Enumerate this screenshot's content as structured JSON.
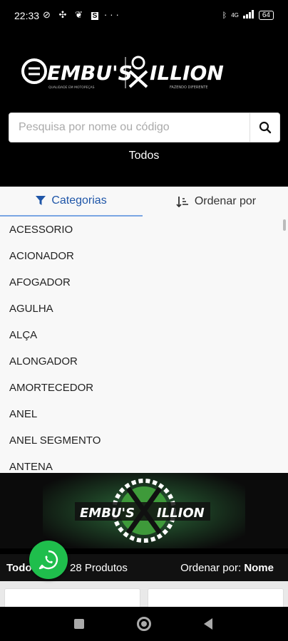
{
  "status_bar": {
    "time": "22:33",
    "left_icons": [
      "wifi-off-icon",
      "fan-icon",
      "twitter-icon",
      "s-app-icon",
      "more-icon"
    ],
    "more": "···",
    "s_app": "S",
    "right_icons": [
      "bluetooth-icon",
      "signal-icon",
      "battery-icon"
    ],
    "network": "4G",
    "battery": "64"
  },
  "header": {
    "logo_left": "EMBU'S",
    "logo_left_tagline": "QUALIDADE EM MOTOPEÇAS",
    "logo_right": "ILLION",
    "logo_right_tagline": "FAZENDO DIFERENTE",
    "search": {
      "placeholder": "Pesquisa por nome ou código",
      "value": ""
    },
    "current_filter": "Todos"
  },
  "tabs": {
    "categories_label": "Categorias",
    "sort_label": "Ordenar por"
  },
  "categories": [
    "ACESSORIO",
    "ACIONADOR",
    "AFOGADOR",
    "AGULHA",
    "ALÇA",
    "ALONGADOR",
    "AMORTECEDOR",
    "ANEL",
    "ANEL SEGMENTO",
    "ANTENA"
  ],
  "products_bar": {
    "filter_label": "Todos",
    "count_text": "28 Produtos",
    "sort_prefix": "Ordenar por:",
    "sort_value": "Nome"
  },
  "colors": {
    "accent": "#1f56a8",
    "whatsapp": "#1fbe4c",
    "header_bg": "#000000"
  }
}
